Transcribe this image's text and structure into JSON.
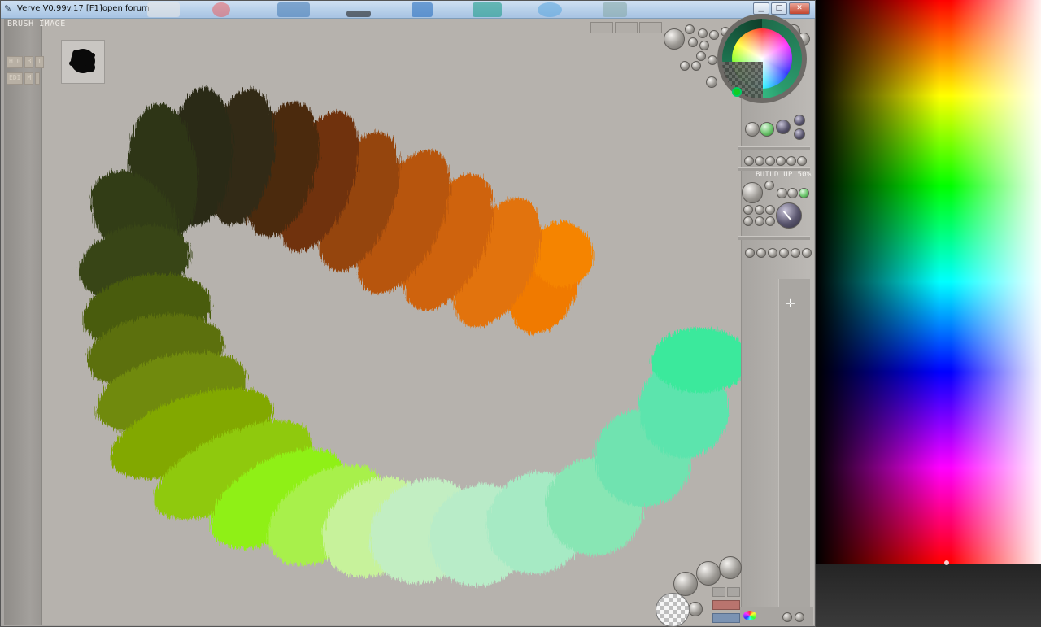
{
  "window": {
    "title": "Verve V0.99v.17 [F1]open forum",
    "minimize_glyph": "▁",
    "maximize_glyph": "□",
    "close_glyph": "✕",
    "app_icon": "verve-icon"
  },
  "left_toolbar": {
    "brush_image_label": "BRUSH IMAGE",
    "row1": [
      "H10",
      "B",
      "I"
    ],
    "row2": [
      "EDI",
      "M ",
      "  "
    ]
  },
  "right_panel": {
    "build_up_label": "BUILD UP 50%",
    "crosshair_glyph": "✛"
  },
  "colors": {
    "canvas": "#b6b2ad",
    "wheel_accent": "#38c98c"
  }
}
